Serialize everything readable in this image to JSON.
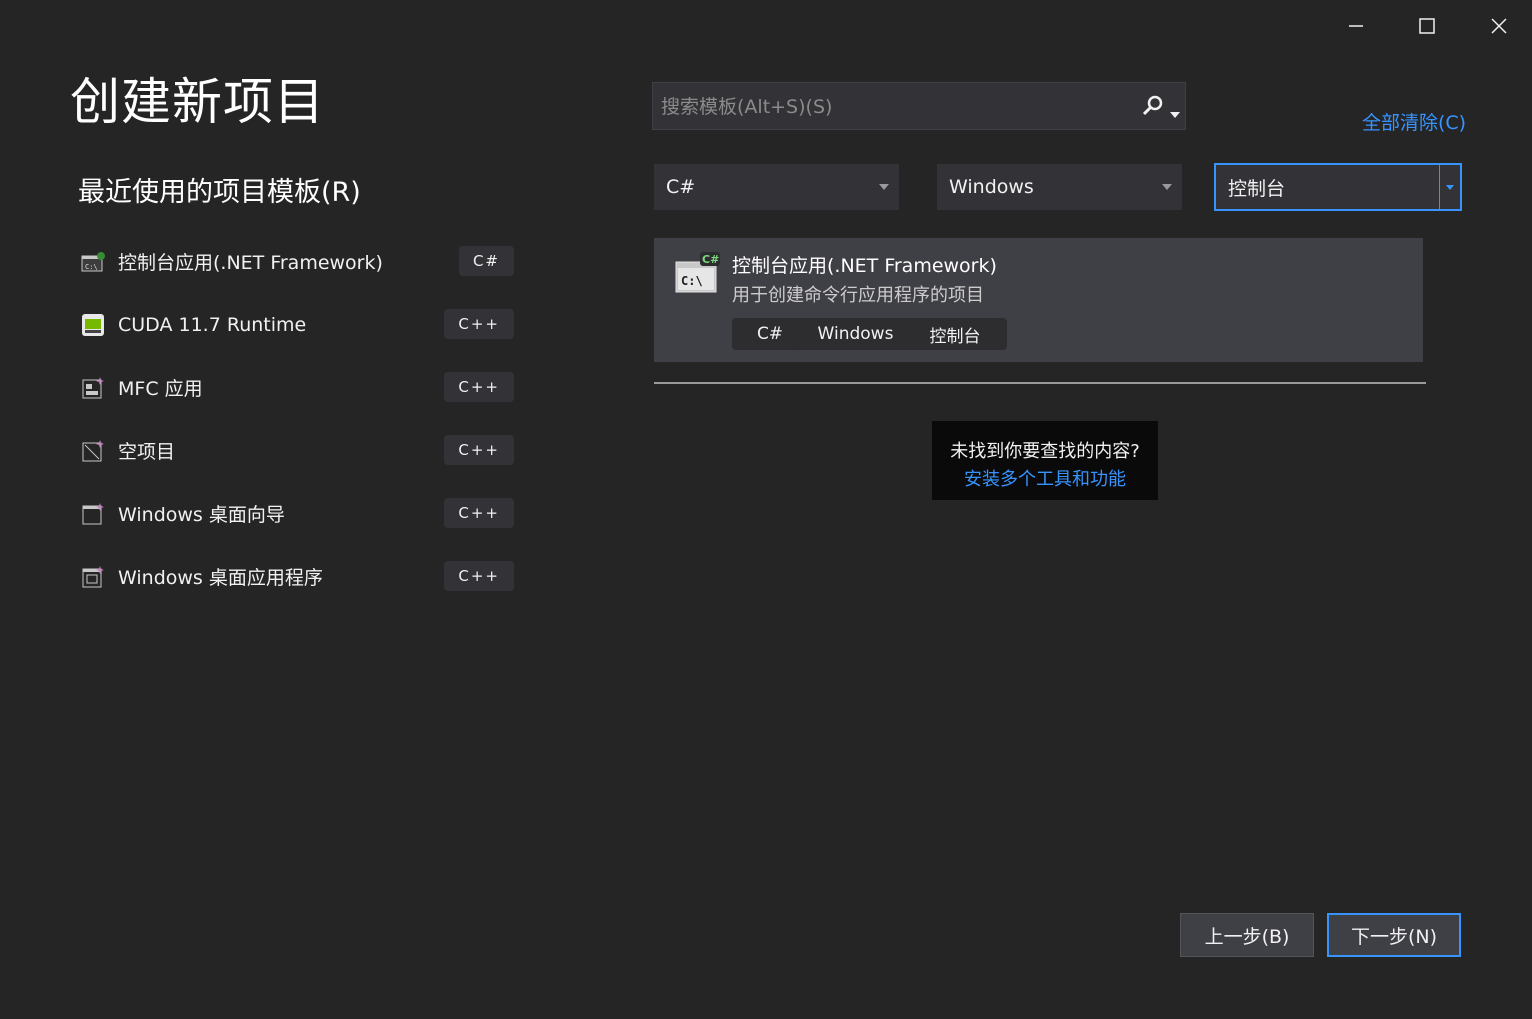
{
  "window": {
    "minimize_icon": "minimize-icon",
    "maximize_icon": "maximize-icon",
    "close_icon": "close-icon"
  },
  "page_title": "创建新项目",
  "recent": {
    "title": "最近使用的项目模板(R)",
    "items": [
      {
        "label": "控制台应用(.NET Framework)",
        "lang": "C#",
        "icon": "console-app-icon"
      },
      {
        "label": "CUDA 11.7 Runtime",
        "lang": "C++",
        "icon": "cuda-icon"
      },
      {
        "label": "MFC 应用",
        "lang": "C++",
        "icon": "mfc-app-icon"
      },
      {
        "label": "空项目",
        "lang": "C++",
        "icon": "empty-project-icon"
      },
      {
        "label": "Windows 桌面向导",
        "lang": "C++",
        "icon": "desktop-wizard-icon"
      },
      {
        "label": "Windows 桌面应用程序",
        "lang": "C++",
        "icon": "desktop-app-icon"
      }
    ]
  },
  "search": {
    "placeholder": "搜索模板(Alt+S)(S)",
    "icon": "search-icon"
  },
  "clear_all": "全部清除(C)",
  "filters": {
    "language": "C#",
    "platform": "Windows",
    "project_type": "控制台"
  },
  "results": [
    {
      "title": "控制台应用(.NET Framework)",
      "description": "用于创建命令行应用程序的项目",
      "tags": [
        "C#",
        "Windows",
        "控制台"
      ],
      "icon": "console-app-icon"
    }
  ],
  "not_found": {
    "question": "未找到你要查找的内容?",
    "link": "安装多个工具和功能"
  },
  "buttons": {
    "back": "上一步(B)",
    "next": "下一步(N)"
  },
  "colors": {
    "background": "#252526",
    "accent": "#3794ff",
    "card": "#3f3f46"
  }
}
